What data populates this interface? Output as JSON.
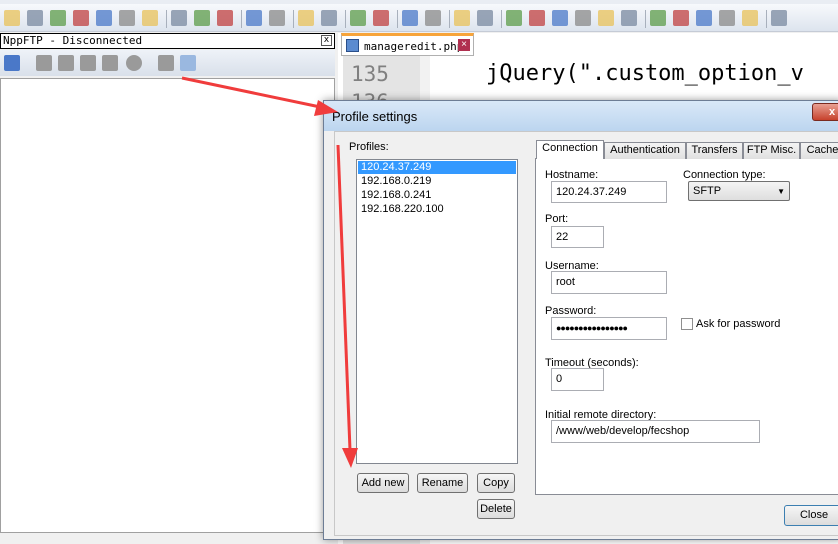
{
  "toolbar": {
    "icons": [
      "new-file",
      "open-file",
      "save",
      "save-all",
      "close",
      "close-all",
      "print",
      "cut",
      "copy",
      "paste",
      "undo",
      "redo",
      "find",
      "replace",
      "zoom-in",
      "zoom-out",
      "sync-vertical",
      "sync-horizontal",
      "word-wrap",
      "show-all-chars",
      "indent-guide",
      "user-language",
      "doc-map",
      "function-list",
      "folder-workspace",
      "monitoring",
      "record-macro",
      "stop-macro",
      "play-macro",
      "run-macro-multiple",
      "save-macro",
      "nppftp"
    ]
  },
  "ftp_panel": {
    "title": "NppFTP - Disconnected",
    "close": "x",
    "icons": [
      "connect",
      "disconnect",
      "download",
      "upload",
      "refresh",
      "abort",
      "settings",
      "message-window"
    ]
  },
  "editor": {
    "tab": "manageredit.php",
    "line_numbers": [
      "135",
      "136"
    ],
    "code": "jQuery(\".custom_option_v"
  },
  "dialog": {
    "title": "Profile settings",
    "profiles_label": "Profiles:",
    "profiles": [
      "120.24.37.249",
      "192.168.0.219",
      "192.168.0.241",
      "192.168.220.100"
    ],
    "selected_profile": "120.24.37.249",
    "buttons": {
      "add_new": "Add new",
      "rename": "Rename",
      "copy": "Copy",
      "delete": "Delete",
      "close": "Close"
    },
    "tabs": [
      "Connection",
      "Authentication",
      "Transfers",
      "FTP Misc.",
      "Cache"
    ],
    "active_tab": "Connection",
    "connection": {
      "hostname_label": "Hostname:",
      "hostname": "120.24.37.249",
      "conn_type_label": "Connection type:",
      "conn_type": "SFTP",
      "port_label": "Port:",
      "port": "22",
      "username_label": "Username:",
      "username": "root",
      "password_label": "Password:",
      "password": "●●●●●●●●●●●●●●●●",
      "ask_password_label": "Ask for password",
      "ask_password": false,
      "timeout_label": "Timeout (seconds):",
      "timeout": "0",
      "remote_dir_label": "Initial remote directory:",
      "remote_dir": "/www/web/develop/fecshop"
    }
  },
  "colors": {
    "selection": "#3399ff",
    "annotation_arrow": "#f03c3c",
    "tab_accent": "#f7a43a"
  }
}
